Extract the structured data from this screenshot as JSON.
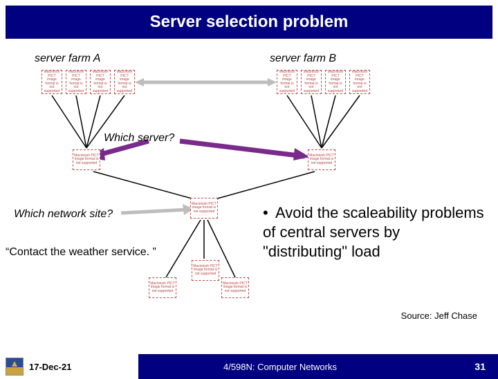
{
  "title": "Server selection problem",
  "labels": {
    "farm_a": "server farm A",
    "farm_b": "server farm B",
    "which_server": "Which server?",
    "which_network": "Which network site?",
    "contact": "“Contact the weather service. ”"
  },
  "placeholder_text": "Macintosh PICT image format is not supported",
  "bullet": {
    "text": "Avoid the scaleability problems of central servers by \"distributing\" load"
  },
  "source": "Source: Jeff Chase",
  "footer": {
    "date": "17-Dec-21",
    "course": "4/598N: Computer Networks",
    "page": "31"
  },
  "colors": {
    "title_bg": "#000080",
    "arrow_purple": "#7a2a8a",
    "arrow_gray": "#bdbdbd"
  }
}
